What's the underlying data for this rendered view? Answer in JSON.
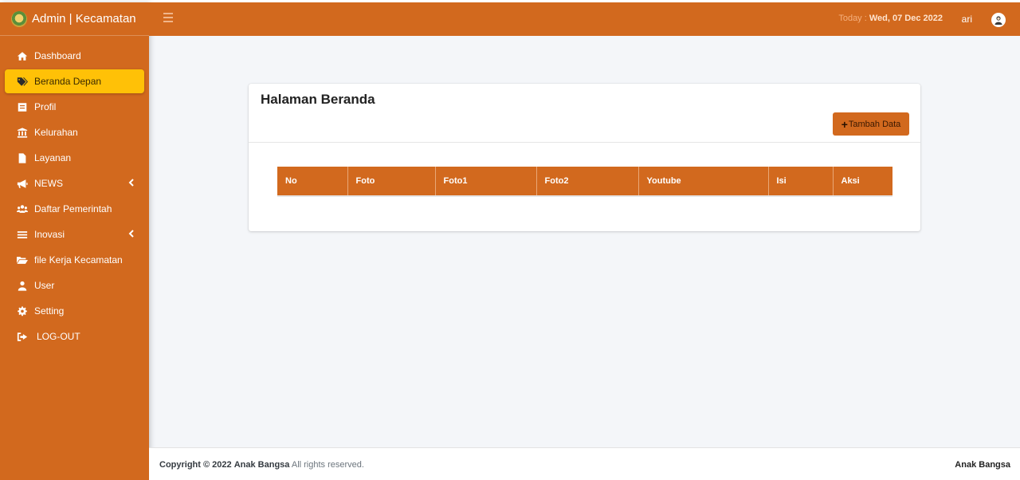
{
  "brand": {
    "title": "Admin | Kecamatan",
    "logo_icon": "regency-emblem"
  },
  "header": {
    "menu_icon": "hamburger-icon",
    "today_label": "Today :",
    "today_date": "Wed, 07 Dec 2022",
    "user_name": "ari",
    "avatar_icon": "user-avatar-icon"
  },
  "sidebar": {
    "active_color": "#ffc107",
    "items": [
      {
        "label": "Dashboard",
        "icon": "home-icon"
      },
      {
        "label": "Beranda Depan",
        "icon": "tags-icon",
        "active": true
      },
      {
        "label": "Profil",
        "icon": "id-card-icon"
      },
      {
        "label": "Kelurahan",
        "icon": "landmark-icon"
      },
      {
        "label": "Layanan",
        "icon": "file-icon"
      },
      {
        "label": "NEWS",
        "icon": "megaphone-icon",
        "has_submenu": true
      },
      {
        "label": "Daftar Pemerintah",
        "icon": "users-icon"
      },
      {
        "label": "Inovasi",
        "icon": "bars-icon",
        "has_submenu": true
      },
      {
        "label": "file Kerja Kecamatan",
        "icon": "folder-open-icon"
      },
      {
        "label": "User",
        "icon": "user-icon"
      },
      {
        "label": "Setting",
        "icon": "cog-icon"
      },
      {
        "label": "LOG-OUT",
        "icon": "sign-out-icon"
      }
    ]
  },
  "main": {
    "card_title": "Halaman Beranda",
    "add_button": "Tambah Data",
    "table": {
      "columns": [
        "No",
        "Foto",
        "Foto1",
        "Foto2",
        "Youtube",
        "Isi",
        "Aksi"
      ],
      "rows": []
    }
  },
  "footer": {
    "copyright_prefix": "Copyright © 2022",
    "copyright_org": "Anak Bangsa",
    "copyright_suffix": "All rights reserved.",
    "right_text": "Anak Bangsa"
  },
  "colors": {
    "primary": "#d2691e",
    "accent": "#ffc107",
    "background": "#f4f6f9"
  }
}
